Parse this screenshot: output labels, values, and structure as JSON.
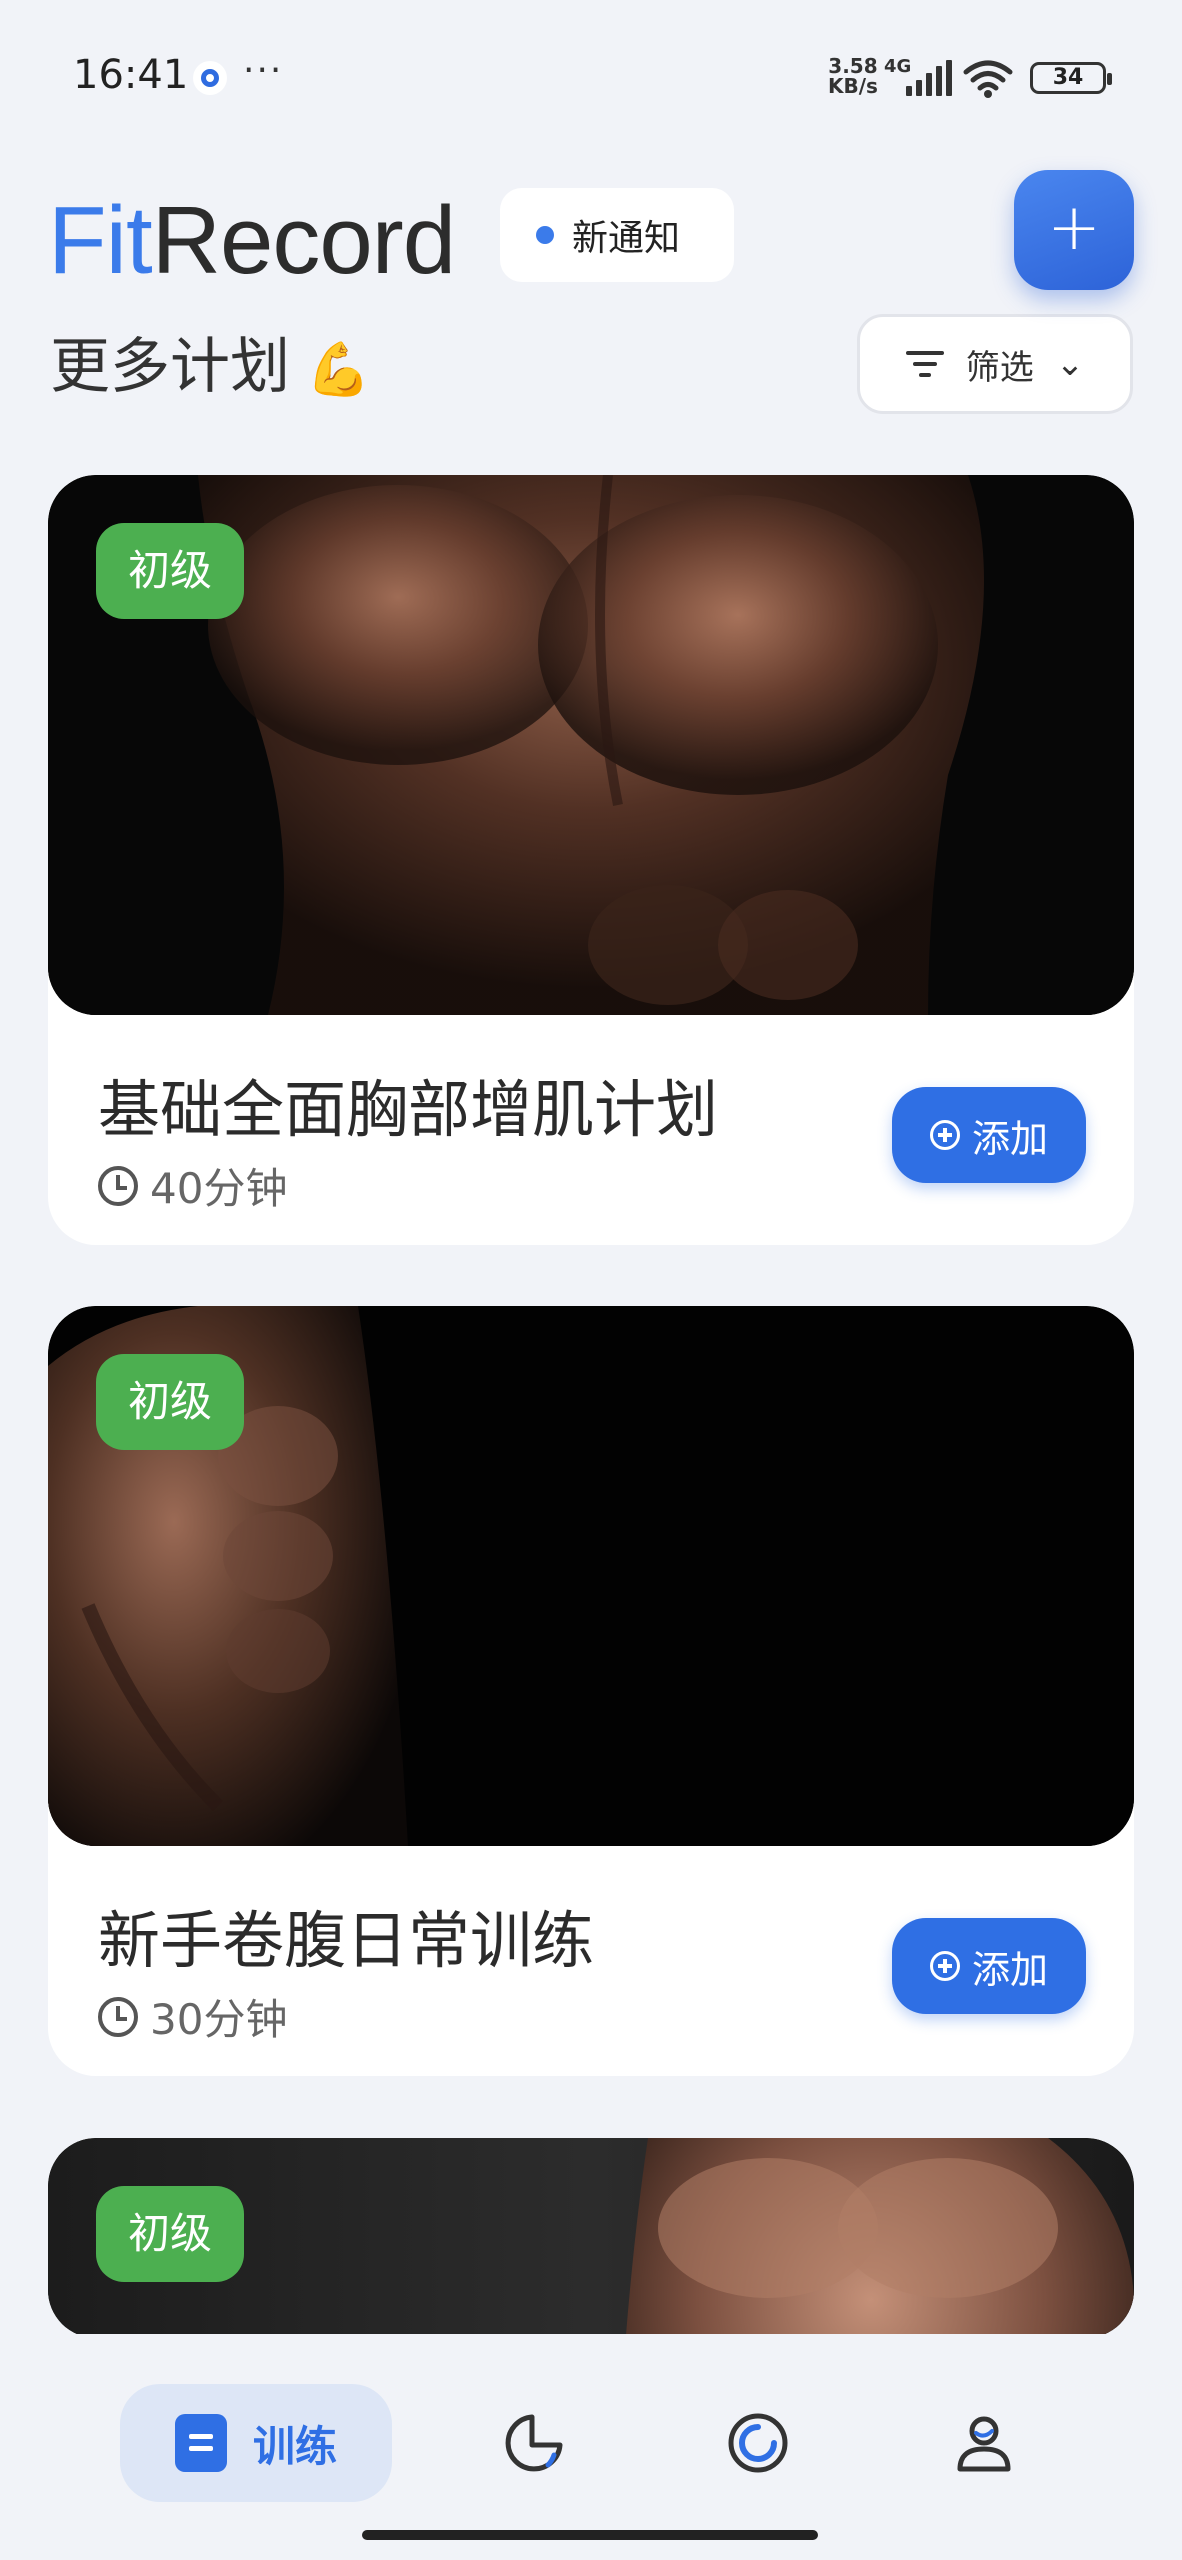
{
  "status_bar": {
    "time": "16:41",
    "more": "···",
    "speed_value": "3.58",
    "speed_unit": "KB/s",
    "network": "4G",
    "battery": "34"
  },
  "header": {
    "brand_fit": "Fit",
    "brand_record": "Record",
    "notice_label": "新通知",
    "add_icon": "+"
  },
  "section": {
    "title": "更多计划",
    "emoji": "💪",
    "filter_label": "筛选",
    "filter_chevron": "⌄"
  },
  "plans": [
    {
      "level": "初级",
      "name": "基础全面胸部增肌计划",
      "duration": "40分钟",
      "add_label": "添加"
    },
    {
      "level": "初级",
      "name": "新手卷腹日常训练",
      "duration": "30分钟",
      "add_label": "添加"
    },
    {
      "level": "初级"
    }
  ],
  "bottom_nav": {
    "train_label": "训练"
  },
  "colors": {
    "accent": "#2f6fe4",
    "brand_fit": "#3b7bea",
    "level_badge": "#4caf50",
    "background": "#f1f3f8"
  },
  "icons": {
    "status": [
      "app-notification-icon",
      "signal-icon",
      "wifi-icon",
      "battery-icon"
    ],
    "header": [
      "plus-icon"
    ],
    "filter": "filter-icon",
    "card": [
      "clock-icon",
      "plus-circle-icon"
    ],
    "nav": [
      "document-icon",
      "pie-chart-icon",
      "progress-ring-icon",
      "user-icon"
    ]
  }
}
